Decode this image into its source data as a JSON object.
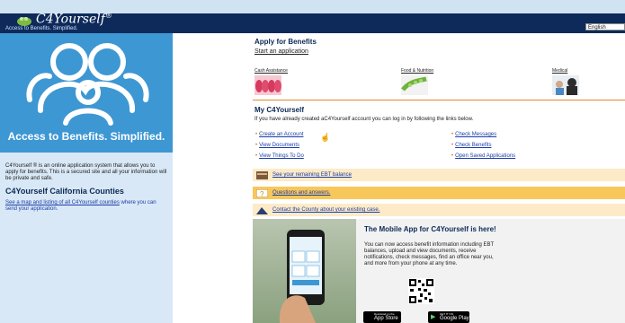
{
  "header": {
    "brand": "C4Yourself",
    "brand_sup": "®",
    "tagline": "Access to Benefits. Simplified.",
    "language": "English"
  },
  "sidebar": {
    "hero_text": "Access to Benefits. Simplified.",
    "description": "C4Yourself ® is an online application system that allows you to apply for benefits. This is a secured site and all your information will be private and safe.",
    "counties_heading": "C4Yourself California Counties",
    "counties_link": "See a map and listing of all C4Yourself counties",
    "counties_text": " where you can send your application."
  },
  "apply": {
    "heading": "Apply for Benefits",
    "start_link": "Start an application",
    "categories": [
      {
        "label": "Cash Assistance"
      },
      {
        "label": "Food & Nutrition"
      },
      {
        "label": "Medical"
      }
    ]
  },
  "my": {
    "heading": "My C4Yourself",
    "intro": "If you have already created aC4Yourself account you can log in by following the links below.",
    "links_left": [
      "Create an Account",
      "View Documents",
      "View Things To Do"
    ],
    "links_right": [
      "Check Messages",
      "Check Benefits",
      "Open Saved Applications"
    ]
  },
  "bars": {
    "ebt": "See your remaining EBT balance",
    "qa": "Questions and answers.",
    "county": "Contact the County about your existing case."
  },
  "app": {
    "title": "The Mobile App for C4Yourself is here!",
    "desc": "You can now access benefit information including EBT balances, upload and view documents, receive notifications, check messages, find an office near you, and more from your phone at any time.",
    "appstore_small": "Download on the",
    "appstore_big": "App Store",
    "google_small": "GET IT ON",
    "google_big": "Google Play"
  },
  "colors": {
    "header_bg": "#0d2a5a",
    "hero_bg": "#3d97d3",
    "sidebar_bg": "#d9e8f6",
    "ebt_bar": "#fdebc8",
    "qa_bar": "#f8c75a",
    "county_bar": "#fdebc8",
    "divider": "#e08a30"
  }
}
